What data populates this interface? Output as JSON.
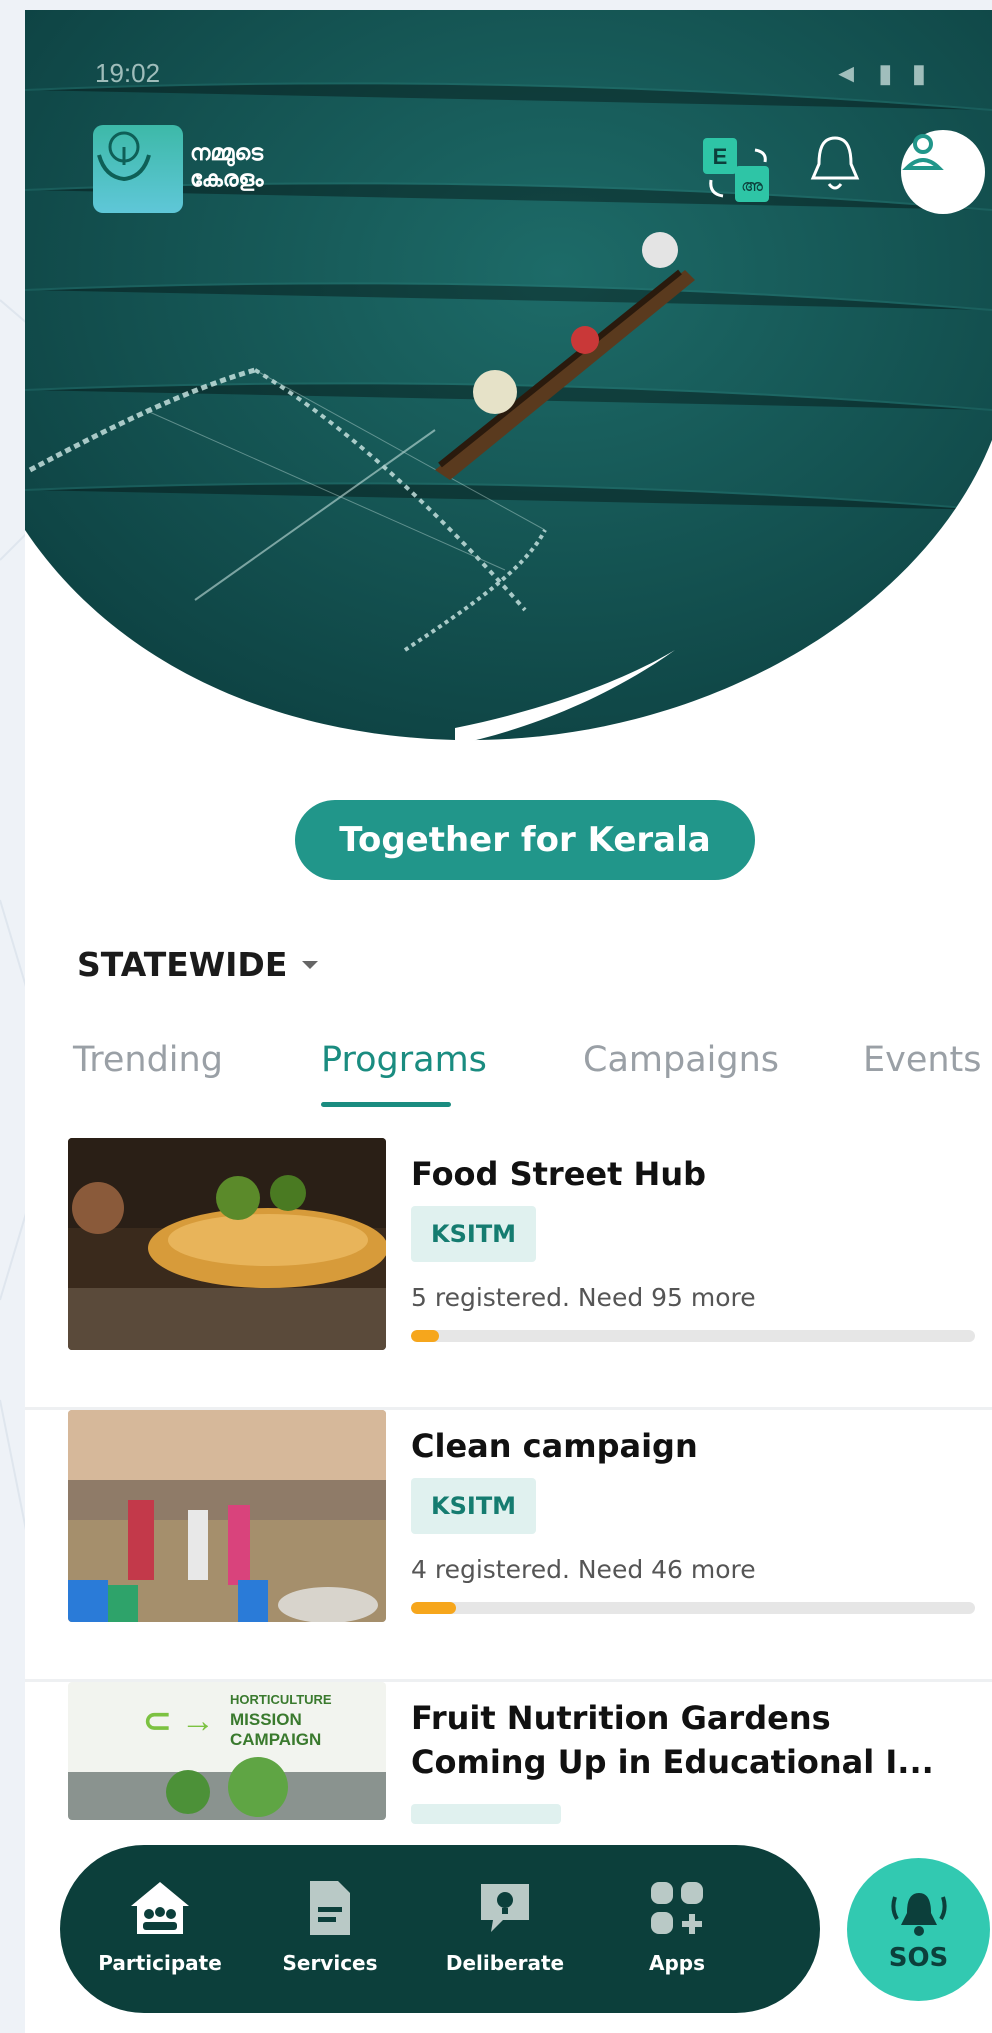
{
  "status_bar": {
    "time": "19:02",
    "right_icons": "◄ ▮ ▮"
  },
  "header": {
    "logo_text_line1": "നമ്മുടെ",
    "logo_text_line2": "കേരളം",
    "language_icon_label": "E"
  },
  "hero": {
    "cta_label": "Together for Kerala"
  },
  "region": {
    "label": "STATEWIDE"
  },
  "tabs": [
    {
      "label": "Trending",
      "active": false
    },
    {
      "label": "Programs",
      "active": true
    },
    {
      "label": "Campaigns",
      "active": false
    },
    {
      "label": "Events",
      "active": false
    }
  ],
  "programs": [
    {
      "title": "Food Street Hub",
      "tag": "KSITM",
      "registration": "5 registered. Need 95 more",
      "progress": 0.05
    },
    {
      "title": "Clean campaign",
      "tag": "KSITM",
      "registration": "4 registered. Need 46 more",
      "progress": 0.08
    },
    {
      "title": "Fruit Nutrition Gardens Coming Up in Educational I...",
      "thumb_text_line1": "HORTICULTURE",
      "thumb_text_line2": "MISSION",
      "thumb_text_line3": "CAMPAIGN"
    }
  ],
  "bottom_nav": [
    {
      "label": "Participate",
      "icon": "community-house-icon"
    },
    {
      "label": "Services",
      "icon": "document-icon"
    },
    {
      "label": "Deliberate",
      "icon": "idea-chat-icon"
    },
    {
      "label": "Apps",
      "icon": "apps-grid-icon"
    }
  ],
  "sos": {
    "label": "SOS"
  },
  "colors": {
    "accent": "#21968a",
    "nav_bg": "#0c3f3b",
    "sos_bg": "#32c9b1",
    "progress": "#f6a61c"
  }
}
